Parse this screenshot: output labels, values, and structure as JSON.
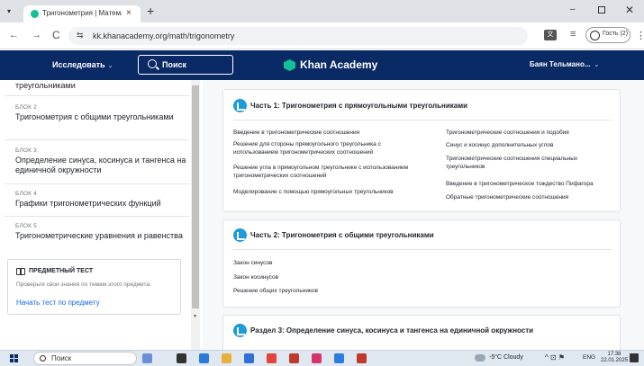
{
  "browser": {
    "tab_title": "Тригонометрия | Математика",
    "tab_close": "×",
    "new_tab": "+",
    "minimize": "–",
    "close": "✕",
    "back": "←",
    "forward": "→",
    "reload": "C",
    "site_info": "⇆",
    "url": "kk.khanacademy.org/math/trigonometry",
    "profile_label": "Гость (2)",
    "menu": "⋮"
  },
  "header": {
    "explore_label": "Исследовать",
    "search_label": "Поиск",
    "logo_text": "Khan Academy",
    "user_name": "Баян Тельмано...",
    "chevron": "⌄"
  },
  "sidebar": {
    "truncated_title": "треугольниками",
    "units": [
      {
        "kicker": "БЛОК 2",
        "title": "Тригонометрия с общими треугольниками"
      },
      {
        "kicker": "БЛОК 3",
        "title": "Определение синуса, косинуса и тангенса на единичной окружности"
      },
      {
        "kicker": "БЛОК 4",
        "title": "Графики тригонометрических функций"
      },
      {
        "kicker": "БЛОК 5",
        "title": "Тригонометрические уравнения и равенства"
      }
    ],
    "unit_test": {
      "heading": "ПРЕДМЕТНЫЙ ТЕСТ",
      "description": "Проверьте свои знания по темам этого предмета.",
      "link": "Начать тест по предмету"
    }
  },
  "main": {
    "part1": {
      "title": "Часть 1: Тригонометрия с прямоугольными треугольниками",
      "left": [
        "Введение в тригонометрические соотношения",
        "Решение для стороны прямоугольного треугольника с использованием тригонометрических соотношений",
        "Решение угла в прямоугольном треугольнике с использованием тригонометрических соотношений",
        "Моделирование с помощью прямоугольных треугольников"
      ],
      "right": [
        "Тригонометрические соотношения и подобия",
        "Синус и косинус дополнительных углов",
        "Тригонометрические соотношения специальных треугольников",
        "Введение в тригонометрическое тождество Пифагора",
        "Обратные тригонометрические соотношения"
      ]
    },
    "part2": {
      "title": "Часть 2: Тригонометрия с общими треугольниками",
      "lessons": [
        "Закон синусов",
        "Закон косинусов",
        "Решение общих треугольников"
      ]
    },
    "part3": {
      "title": "Раздел 3: Определение синуса, косинуса и тангенса на единичной окружности"
    }
  },
  "taskbar": {
    "search_label": "Поиск",
    "weather": "-5°C  Cloudy",
    "tray": "^  ⊡  ⚑",
    "lang": "ENG",
    "time": "17:38",
    "date": "22.01.2025"
  }
}
